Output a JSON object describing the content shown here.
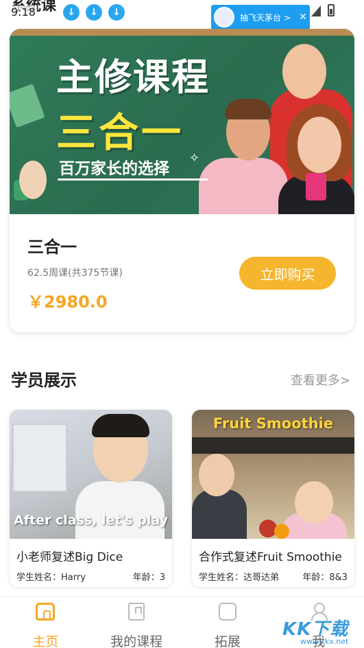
{
  "status_bar": {
    "page_title_partial": "系统课",
    "time": "9:18",
    "dots": "···",
    "download_icons": [
      "download-icon",
      "download-icon",
      "download-icon"
    ],
    "toast": {
      "text": "抽飞天茅台 >",
      "close": "✕"
    }
  },
  "course": {
    "banner": {
      "title": "主修课程",
      "subtitle": "三合一",
      "tagline": "百万家长的选择",
      "sparkle": "✧"
    },
    "name": "三合一",
    "meta": "62.5周课(共375节课)",
    "price": "￥2980.0",
    "buy_label": "立即购买"
  },
  "students_section": {
    "title": "学员展示",
    "see_more": "查看更多>",
    "items": [
      {
        "caption": "After class, let's play",
        "title": "小老师复述Big Dice",
        "name": "学生姓名：Harry",
        "age": "年龄：3"
      },
      {
        "caption": "Fruit Smoothie",
        "title": "合作式复述Fruit Smoothie",
        "name": "学生姓名：达哥达弟",
        "age": "年龄：8&3"
      }
    ]
  },
  "bottom_nav": {
    "items": [
      {
        "label": "主页",
        "icon": "home-icon",
        "active": true
      },
      {
        "label": "我的课程",
        "icon": "book-icon",
        "active": false
      },
      {
        "label": "拓展",
        "icon": "puzzle-icon",
        "active": false
      },
      {
        "label": "我",
        "icon": "person-icon",
        "active": false
      }
    ]
  },
  "watermark": {
    "text": "KK下载",
    "url": "www.kkx.net"
  },
  "colors": {
    "accent": "#f5a623",
    "button": "#f5b52c",
    "toast": "#1d9ef0",
    "banner_green": "#2b6b4f"
  }
}
